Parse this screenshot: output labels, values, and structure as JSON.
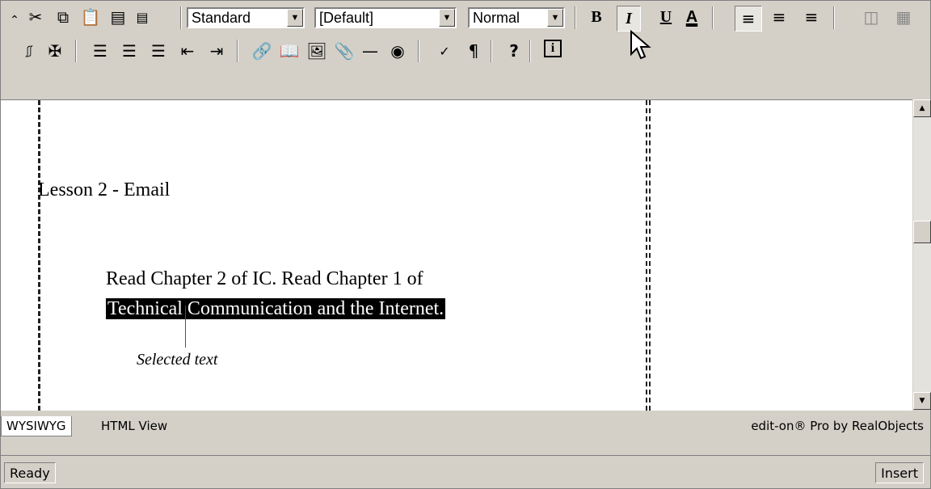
{
  "toolbar1": {
    "style_select": "Standard",
    "font_select": "[Default]",
    "size_select": "Normal",
    "bold": "B",
    "italic": "I",
    "underline": "U",
    "font_color": "A"
  },
  "toolbar2": {
    "help": "?",
    "info": "i"
  },
  "document": {
    "heading": "Lesson 2 - Email",
    "para_line1": "Read Chapter 2 of IC. Read Chapter 1 of",
    "selected_text": "Technical Communication and the Internet."
  },
  "annotation": {
    "callout": "Selected text"
  },
  "view_tabs": {
    "wysiwyg": "WYSIWYG",
    "html_view": "HTML View"
  },
  "branding": "edit-on® Pro by RealObjects",
  "status": {
    "left": "Ready",
    "right": "Insert"
  }
}
